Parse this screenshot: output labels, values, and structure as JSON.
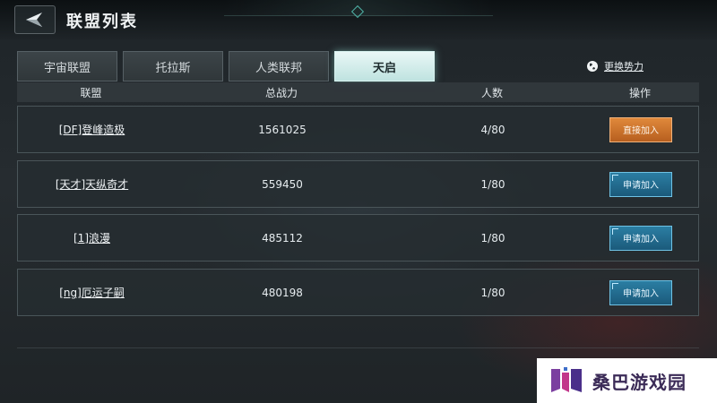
{
  "header": {
    "title": "联盟列表"
  },
  "tabs": [
    {
      "label": "宇宙联盟",
      "active": false
    },
    {
      "label": "托拉斯",
      "active": false
    },
    {
      "label": "人类联邦",
      "active": false
    },
    {
      "label": "天启",
      "active": true
    }
  ],
  "switch_faction": {
    "label": "更换势力",
    "icon": "globe-icon"
  },
  "table": {
    "headers": [
      "联盟",
      "总战力",
      "人数",
      "操作"
    ],
    "rows": [
      {
        "name": "[DF]登峰造极",
        "power": "1561025",
        "members": "4/80",
        "action": "直接加入",
        "action_type": "join"
      },
      {
        "name": "[天才]天纵奇才",
        "power": "559450",
        "members": "1/80",
        "action": "申请加入",
        "action_type": "apply"
      },
      {
        "name": "[1]浪漫",
        "power": "485112",
        "members": "1/80",
        "action": "申请加入",
        "action_type": "apply"
      },
      {
        "name": "[ng]厄运子嗣",
        "power": "480198",
        "members": "1/80",
        "action": "申请加入",
        "action_type": "apply"
      }
    ]
  },
  "colors": {
    "join_button": "#c8702c",
    "apply_button": "#22698d",
    "active_tab": "#d6efec"
  },
  "watermark": {
    "text": "桑巴游戏园"
  }
}
